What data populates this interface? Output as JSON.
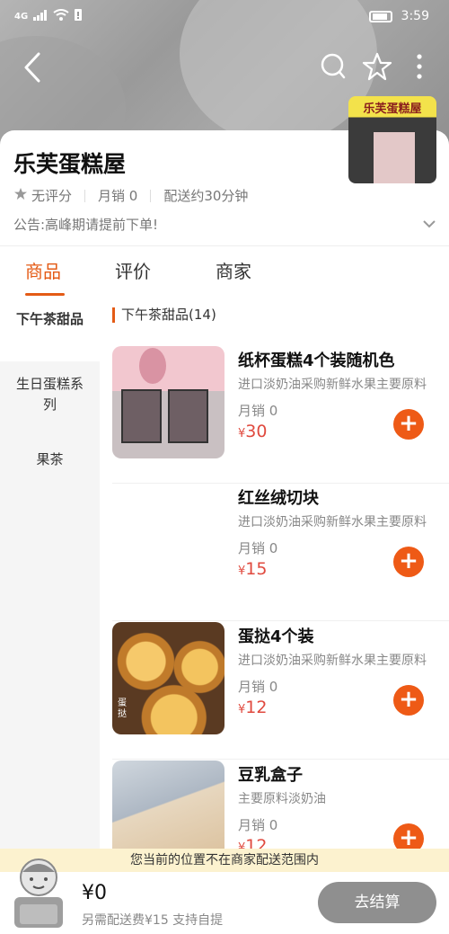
{
  "status_bar": {
    "network": "4G",
    "time": "3:59"
  },
  "shop": {
    "name": "乐芙蛋糕屋",
    "rating": "无评分",
    "monthly_sales": "月销 0",
    "delivery_time": "配送约30分钟",
    "notice": "公告:高峰期请提前下单!",
    "store_sign": "乐芙蛋糕屋"
  },
  "tabs": [
    "商品",
    "评价",
    "商家"
  ],
  "sidebar": [
    {
      "label": "下午茶甜品"
    },
    {
      "label": "生日蛋糕系列"
    },
    {
      "label": "果茶"
    }
  ],
  "category_title": "下午茶甜品(14)",
  "products": [
    {
      "name": "纸杯蛋糕4个装随机色",
      "desc": "进口淡奶油采购新鲜水果主要原料",
      "sales": "月销 0",
      "currency": "¥",
      "price": "30"
    },
    {
      "name": "红丝绒切块",
      "desc": "进口淡奶油采购新鲜水果主要原料",
      "sales": "月销 0",
      "currency": "¥",
      "price": "15"
    },
    {
      "name": "蛋挞4个装",
      "desc": "进口淡奶油采购新鲜水果主要原料",
      "sales": "月销 0",
      "currency": "¥",
      "price": "12",
      "image_tag": "蛋挞"
    },
    {
      "name": "豆乳盒子",
      "desc": "主要原料淡奶油",
      "sales": "月销 0",
      "currency": "¥",
      "price": "12"
    }
  ],
  "range_tip": "您当前的位置不在商家配送范围内",
  "cart": {
    "total": "¥0",
    "fee_text": "另需配送费¥15  支持自提",
    "checkout_label": "去结算"
  },
  "colors": {
    "accent": "#e45b16",
    "price": "#e04a3f",
    "add_button": "#ee5a16"
  }
}
